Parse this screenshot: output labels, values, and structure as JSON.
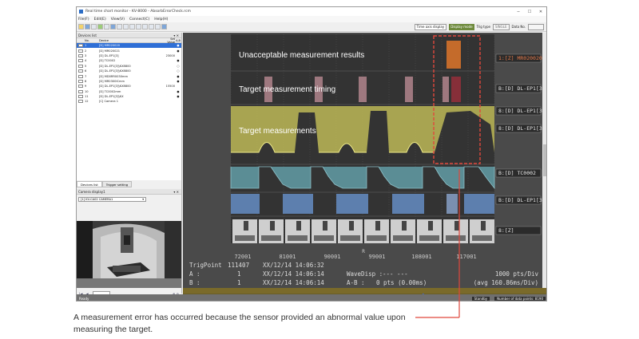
{
  "window": {
    "title": "Real time chart monitor - KV-8000 - AbsorbErrorCheck.rcm",
    "controls": [
      "─",
      "☐",
      "✕"
    ]
  },
  "menu": [
    "File(F)",
    "Edit(E)",
    "View(V)",
    "Connect(C)",
    "Help(H)"
  ],
  "toolbar": {
    "time_axis": "Time axis display",
    "display_mode": "Display mode",
    "trig_label": "Trig type",
    "trig_value": "SINGLE",
    "data_label": "Data No."
  },
  "devices": {
    "panel_title": "Devices list",
    "columns": [
      "No.",
      "Device",
      "Set Value",
      "A-B"
    ],
    "rows": [
      {
        "num": "1",
        "device": "[D] MR020020",
        "value": "",
        "ab": "●"
      },
      {
        "num": "2",
        "device": "[D] MR020021",
        "value": "",
        "ab": "●"
      },
      {
        "num": "3",
        "device": "[D] DL-EP1[3]",
        "value": "23000",
        "ab": ""
      },
      {
        "num": "4",
        "device": "[D] TC0002",
        "value": "",
        "ab": "●"
      },
      {
        "num": "5",
        "device": "[D] DL-EP1[3]\\KX8800",
        "value": "",
        "ab": "○"
      },
      {
        "num": "6",
        "device": "[D] DL-EP1[3]\\KX8800",
        "value": "",
        "ab": "○"
      },
      {
        "num": "7",
        "device": "[D] MD0RR0030mm",
        "value": "",
        "ab": "●"
      },
      {
        "num": "8",
        "device": "[D] MR0300ICmm",
        "value": "",
        "ab": "●"
      },
      {
        "num": "9",
        "device": "[D] DL-EP1[3]\\KX8800",
        "value": "15500",
        "ab": ""
      },
      {
        "num": "10",
        "device": "[D] TC0002mm",
        "value": "",
        "ab": "●"
      },
      {
        "num": "11",
        "device": "[D] DL-EP1[3]\\KX",
        "value": "",
        "ab": "●"
      },
      {
        "num": "12",
        "device": "[C] Camera 1",
        "value": "",
        "ab": ""
      }
    ],
    "tabs": [
      "Devices list",
      "Trigger setting"
    ]
  },
  "camera": {
    "panel_title": "Camera display1",
    "selected": "[1] KV-CA02 CAMERA1"
  },
  "chart": {
    "channel_tags": [
      "1:[Z] MR020020",
      "B:[D] DL-EP1[3]",
      "8:[D] DL-EP1[3]",
      "8:[D] DL-EP1[3]",
      "B:[D] TC0002",
      "B:[D] DL-EP1[3]",
      "8:[Z]"
    ],
    "x_ticks": [
      "72001",
      "81001",
      "90001",
      "99001",
      "108001",
      "117001"
    ],
    "cursor_marker": "R",
    "info": {
      "trig_label": "TrigPoint",
      "trig_value": "111407",
      "trig_date": "XX/12/14 14:06:32",
      "a_label": "A  :",
      "a_num": "1",
      "a_date": "XX/12/14 14:06:14",
      "b_label": "B  :",
      "b_num": "1",
      "b_date": "XX/12/14 14:06:14",
      "wave_label": "WaveDisp :",
      "wave_value": "--- ---",
      "ab_label": "A-B  :",
      "ab_value": "0 pts (0.00ms)",
      "pts_per_div": "1000 pts/Div",
      "avg": "(avg 160.86ms/Div)"
    }
  },
  "annotations": {
    "unacceptable": "Unacceptable measurement results",
    "timing": "Target measurement timing",
    "measurements": "Target measurements"
  },
  "status": {
    "left": "Ready",
    "mid": "Standby",
    "right": "Number of data points: 8190"
  },
  "caption": "A measurement error has occurred because the sensor provided an abnormal value upon measuring the target.",
  "colors": {
    "highlight": "#e0483c",
    "waveform_yellow": "#d9d66a",
    "waveform_teal": "#64a0a8",
    "waveform_blue": "#6e8fbf",
    "timing_pink": "#d7a3ab",
    "result_orange": "#e07a2a"
  }
}
